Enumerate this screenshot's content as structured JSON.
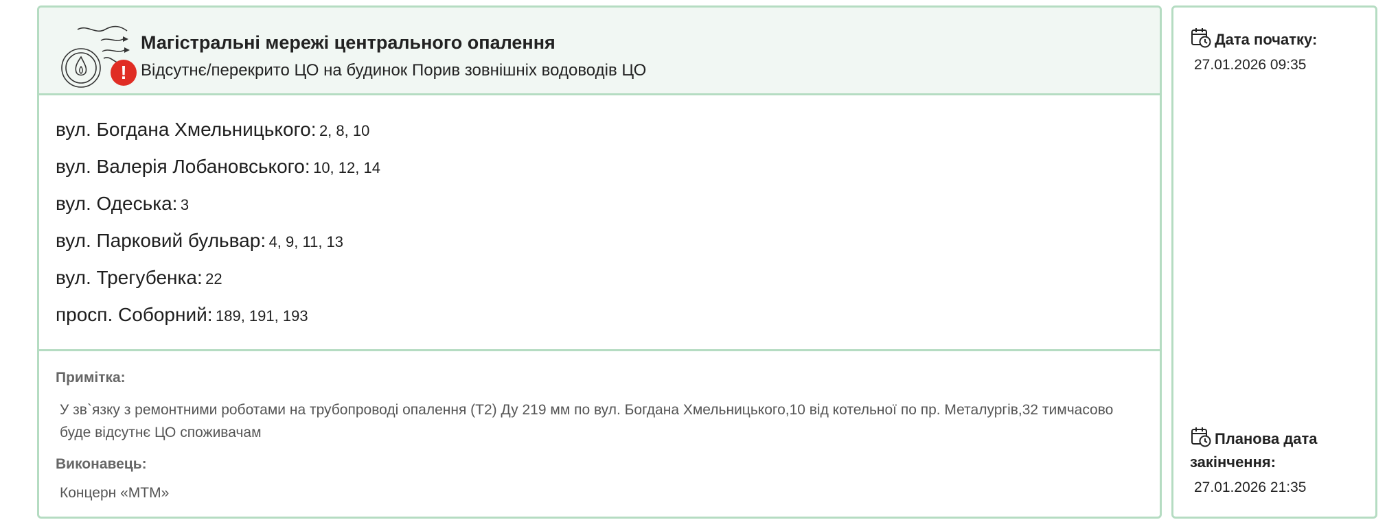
{
  "header": {
    "icon": "heating-network-icon",
    "alert_icon": "exclamation-icon",
    "alert_symbol": "!",
    "title": "Магістральні мережі центрального опалення",
    "subtitle": "Відсутнє/перекрито ЦО на будинок Порив зовнішніх водоводів ЦО"
  },
  "streets": [
    {
      "name": "вул. Богдана Хмельницького:",
      "houses": "2, 8, 10"
    },
    {
      "name": "вул. Валерія Лобановського:",
      "houses": "10, 12, 14"
    },
    {
      "name": "вул. Одеська:",
      "houses": "3"
    },
    {
      "name": "вул. Парковий бульвар:",
      "houses": "4, 9, 11, 13"
    },
    {
      "name": "вул. Трегубенка:",
      "houses": "22"
    },
    {
      "name": "просп. Соборний:",
      "houses": "189, 191, 193"
    }
  ],
  "note": {
    "label": "Примітка:",
    "text": "У зв`язку з ремонтними роботами на трубопроводі опалення (Т2) Ду 219 мм по вул. Богдана Хмельницького,10 від котельної по пр. Металургів,32 тимчасово буде відсутнє ЦО споживачам"
  },
  "contractor": {
    "label": "Виконавець:",
    "value": "Концерн «МТМ»"
  },
  "dates": {
    "start_label": "Дата початку:",
    "start_value": "27.01.2026 09:35",
    "end_label": "Планова дата закінчення:",
    "end_value": "27.01.2026 21:35"
  },
  "colors": {
    "accent_border": "#b5dcc2",
    "header_bg": "#f1f7f3",
    "alert": "#e02d24"
  }
}
